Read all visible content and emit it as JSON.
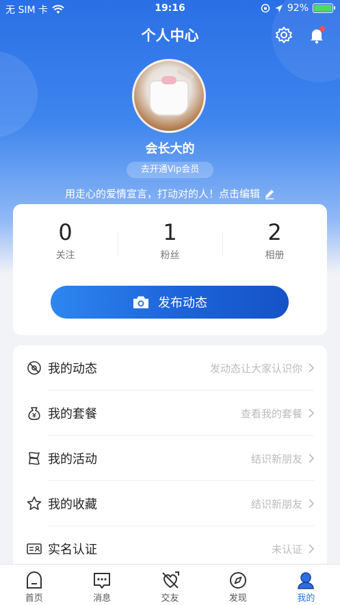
{
  "status_bar": {
    "carrier": "无 SIM 卡",
    "time": "19:16",
    "battery": "92%"
  },
  "header": {
    "title": "个人中心",
    "settings_icon": "gear-icon",
    "notification_icon": "bell-icon"
  },
  "profile": {
    "username": "会长大的",
    "vip_button": "去开通Vip会员",
    "bio": "用走心的爱情宣言，打动对的人！点击编辑"
  },
  "stats": [
    {
      "value": "0",
      "label": "关注"
    },
    {
      "value": "1",
      "label": "粉丝"
    },
    {
      "value": "2",
      "label": "相册"
    }
  ],
  "publish_button": "发布动态",
  "menu": [
    {
      "label": "我的动态",
      "hint": "发动态让大家认识你",
      "icon": "no-camera-icon"
    },
    {
      "label": "我的套餐",
      "hint": "查看我的套餐",
      "icon": "money-bag-icon"
    },
    {
      "label": "我的活动",
      "hint": "结识新朋友",
      "icon": "flag-icon"
    },
    {
      "label": "我的收藏",
      "hint": "结识新朋友",
      "icon": "star-icon"
    },
    {
      "label": "实名认证",
      "hint": "未认证",
      "icon": "id-card-icon"
    }
  ],
  "tabs": [
    {
      "label": "首页",
      "icon": "home-icon",
      "active": false
    },
    {
      "label": "消息",
      "icon": "message-icon",
      "active": false
    },
    {
      "label": "交友",
      "icon": "dating-icon",
      "active": false
    },
    {
      "label": "发现",
      "icon": "compass-icon",
      "active": false
    },
    {
      "label": "我的",
      "icon": "profile-icon",
      "active": true
    }
  ],
  "colors": {
    "accent": "#2b6fe6",
    "notification_dot": "#ff4d4f",
    "battery": "#4cd964"
  }
}
